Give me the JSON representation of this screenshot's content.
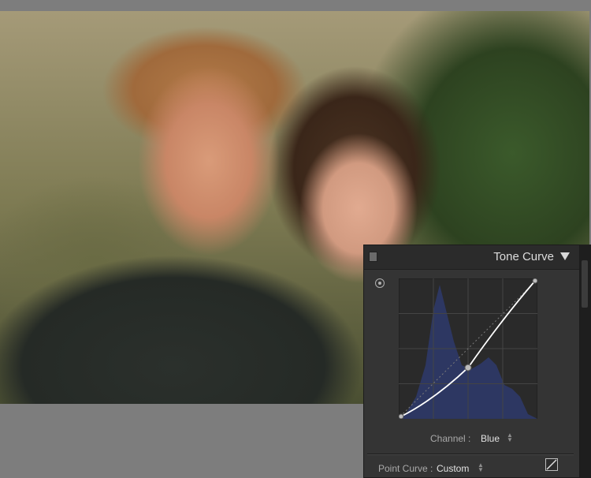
{
  "panel": {
    "title": "Tone Curve",
    "channel_label": "Channel :",
    "channel_value": "Blue",
    "point_curve_label": "Point Curve :",
    "point_curve_value": "Custom"
  },
  "curve": {
    "points": [
      [
        0,
        0
      ],
      [
        0.5,
        0.36
      ],
      [
        1,
        1
      ]
    ],
    "line_color": "#ffffff",
    "histogram_color": "#2e3a6c"
  },
  "icons": {
    "collapse": "triangle-down-icon",
    "target": "target-adjust-icon",
    "curve_toggle": "linear-curve-icon",
    "panel_toggle": "panel-switch-icon"
  },
  "colors": {
    "panel_bg": "#343434",
    "header_bg": "#2b2b2b",
    "workspace_bg": "#7d7d7d"
  }
}
